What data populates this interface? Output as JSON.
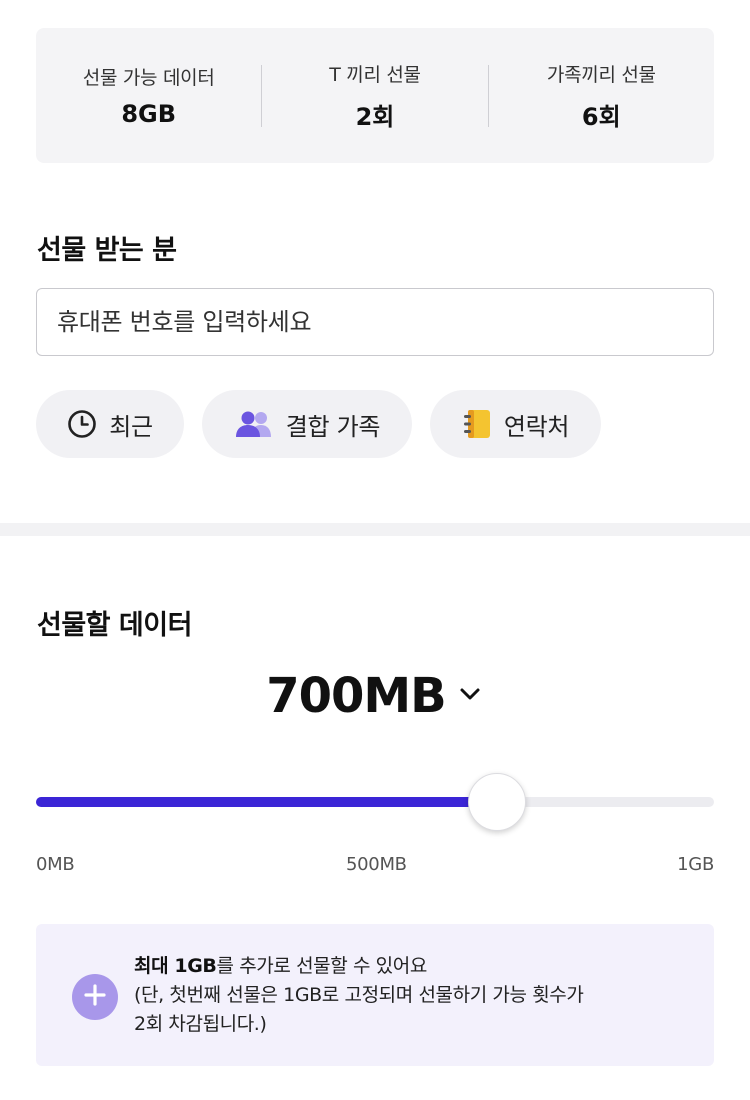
{
  "summary": {
    "items": [
      {
        "label": "선물 가능 데이터",
        "value": "8GB"
      },
      {
        "label": "T 끼리 선물",
        "value": "2회"
      },
      {
        "label": "가족끼리 선물",
        "value": "6회"
      }
    ]
  },
  "recipient": {
    "title": "선물 받는 분",
    "input_placeholder": "휴대폰 번호를 입력하세요",
    "chips": [
      {
        "label": "최근",
        "icon": "clock-icon"
      },
      {
        "label": "결합 가족",
        "icon": "family-icon"
      },
      {
        "label": "연락처",
        "icon": "contacts-book-icon"
      }
    ]
  },
  "gift_data": {
    "title": "선물할 데이터",
    "amount": "700MB",
    "slider": {
      "min_label": "0MB",
      "mid_label": "500MB",
      "max_label": "1GB",
      "value_fraction": 0.68
    },
    "info": {
      "bold": "최대 1GB",
      "line1_rest": "를 추가로 선물할 수 있어요",
      "line2": "(단, 첫번째 선물은 1GB로 고정되며 선물하기 가능 횟수가",
      "line3": "2회 차감됩니다.)"
    }
  },
  "colors": {
    "accent": "#3b25d6",
    "plus_button": "#a897ea",
    "info_bg": "#f3f1fc",
    "summary_bg": "#f4f4f6"
  }
}
